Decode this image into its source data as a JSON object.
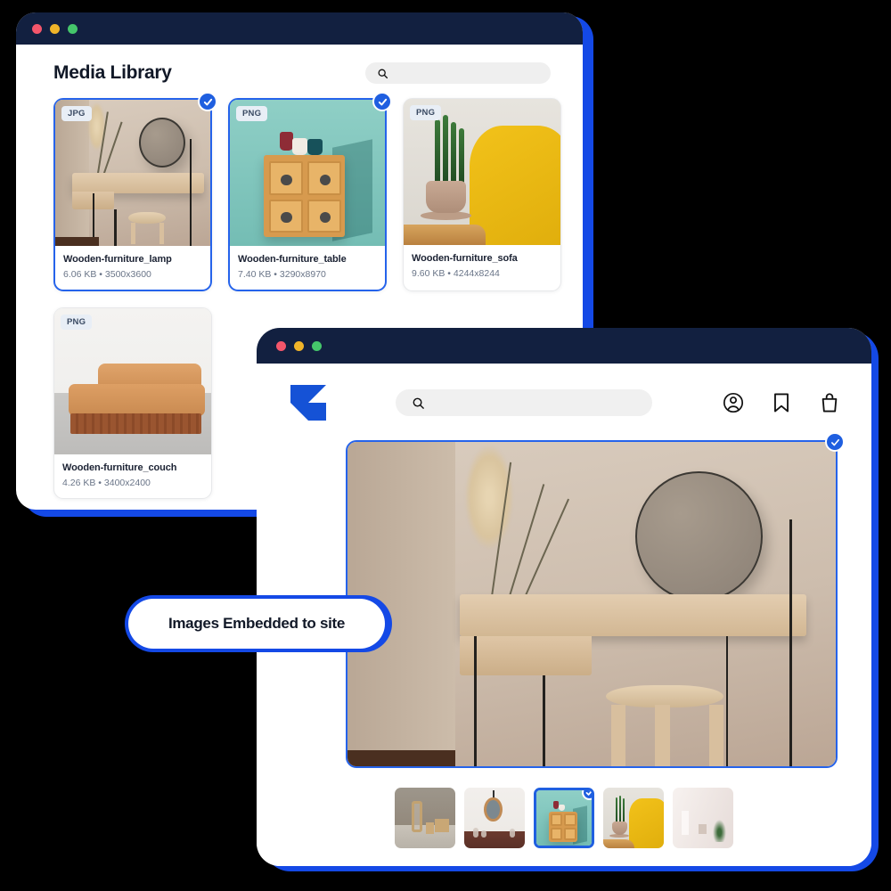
{
  "window_library": {
    "title": "Media Library",
    "traffic_lights": [
      "close",
      "minimize",
      "maximize"
    ],
    "search": {
      "placeholder": "",
      "value": "",
      "icon": "search-icon"
    },
    "files": [
      {
        "type_badge": "JPG",
        "name": "Wooden-furniture_lamp",
        "size": "6.06 KB",
        "separator": "•",
        "dimensions": "3500x3600",
        "selected": true,
        "scene": "vanity"
      },
      {
        "type_badge": "PNG",
        "name": "Wooden-furniture_table",
        "size": "7.40 KB",
        "separator": "•",
        "dimensions": "3290x8970",
        "selected": true,
        "scene": "cabinet"
      },
      {
        "type_badge": "PNG",
        "name": "Wooden-furniture_sofa",
        "size": "9.60 KB",
        "separator": "•",
        "dimensions": "4244x8244",
        "selected": false,
        "scene": "chair"
      },
      {
        "type_badge": "PNG",
        "name": "Wooden-furniture_couch",
        "size": "4.26 KB",
        "separator": "•",
        "dimensions": "3400x2400",
        "selected": false,
        "scene": "couch"
      }
    ]
  },
  "window_store": {
    "traffic_lights": [
      "close",
      "minimize",
      "maximize"
    ],
    "logo": "brand-logo-k",
    "search": {
      "placeholder": "",
      "value": "",
      "icon": "search-icon"
    },
    "actions": [
      {
        "icon": "user-account-icon"
      },
      {
        "icon": "bookmark-icon"
      },
      {
        "icon": "shopping-bag-icon"
      }
    ],
    "preview": {
      "selected": true,
      "scene": "vanity",
      "check_icon": "check-icon"
    },
    "thumbnails": [
      {
        "scene": "room1",
        "selected": false
      },
      {
        "scene": "room2",
        "selected": false
      },
      {
        "scene": "cabinet",
        "selected": true
      },
      {
        "scene": "chair",
        "selected": false
      },
      {
        "scene": "room3",
        "selected": false
      }
    ]
  },
  "callout": {
    "label": "Images Embedded to site"
  },
  "colors": {
    "background": "#000000",
    "accent_blue": "#1449E6",
    "selection_blue": "#2563EB",
    "check_blue": "#1F5FE0",
    "titlebar": "#122040",
    "badge_bg": "#E8EEF6",
    "text_primary": "#1B2233",
    "text_secondary": "#6A7588"
  }
}
